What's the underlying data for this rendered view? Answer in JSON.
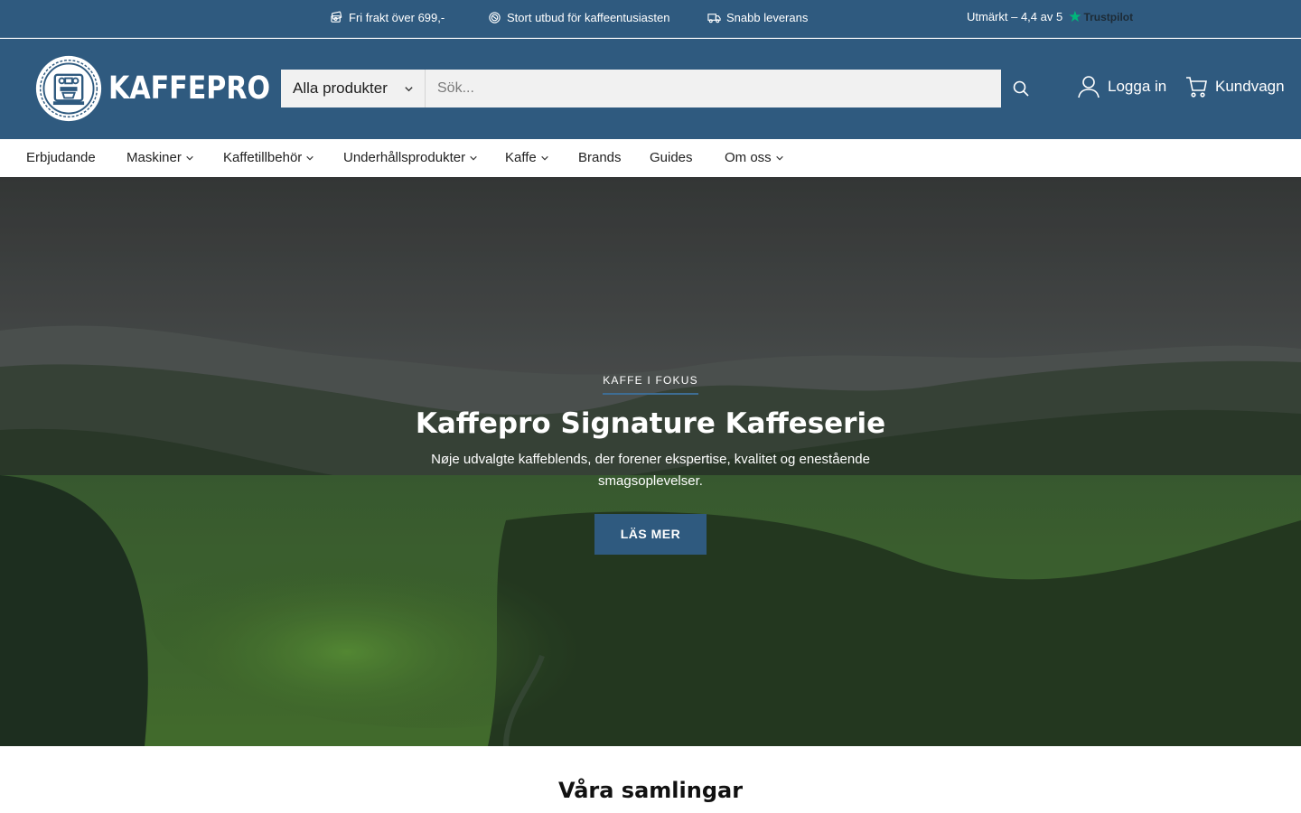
{
  "announcement": {
    "usps": [
      {
        "icon": "money-icon",
        "label": "Fri frakt över 699,-"
      },
      {
        "icon": "coffee-beans-icon",
        "label": "Stort utbud för kaffeentusiasten"
      },
      {
        "icon": "truck-icon",
        "label": "Snabb leverans"
      }
    ],
    "rating_text": "Utmärkt – 4,4 av 5",
    "rating_brand": "Trustpilot",
    "rating_star": "★"
  },
  "header": {
    "logo_text": "KAFFEPRO",
    "search": {
      "category": "Alla produkter",
      "placeholder": "Sök..."
    },
    "login_label": "Logga in",
    "cart_label": "Kundvagn"
  },
  "nav": {
    "items": [
      {
        "label": "Erbjudande",
        "dropdown": false
      },
      {
        "label": "Maskiner",
        "dropdown": true
      },
      {
        "label": "Kaffetillbehör",
        "dropdown": true
      },
      {
        "label": "Underhållsprodukter",
        "dropdown": true
      },
      {
        "label": "Kaffe",
        "dropdown": true
      },
      {
        "label": "Brands",
        "dropdown": false
      },
      {
        "label": "Guides",
        "dropdown": false
      },
      {
        "label": "Om oss",
        "dropdown": true
      }
    ]
  },
  "hero": {
    "eyebrow": "KAFFE I FOKUS",
    "title": "Kaffepro Signature Kaffeserie",
    "subtitle": "Nøje udvalgte kaffeblends, der forener ekspertise, kvalitet og enestående smagsoplevelser.",
    "button_label": "LÄS MER"
  },
  "collections": {
    "title": "Våra samlingar"
  },
  "colors": {
    "brand_blue": "#2f5a7f",
    "trustpilot_green": "#00b67a"
  }
}
